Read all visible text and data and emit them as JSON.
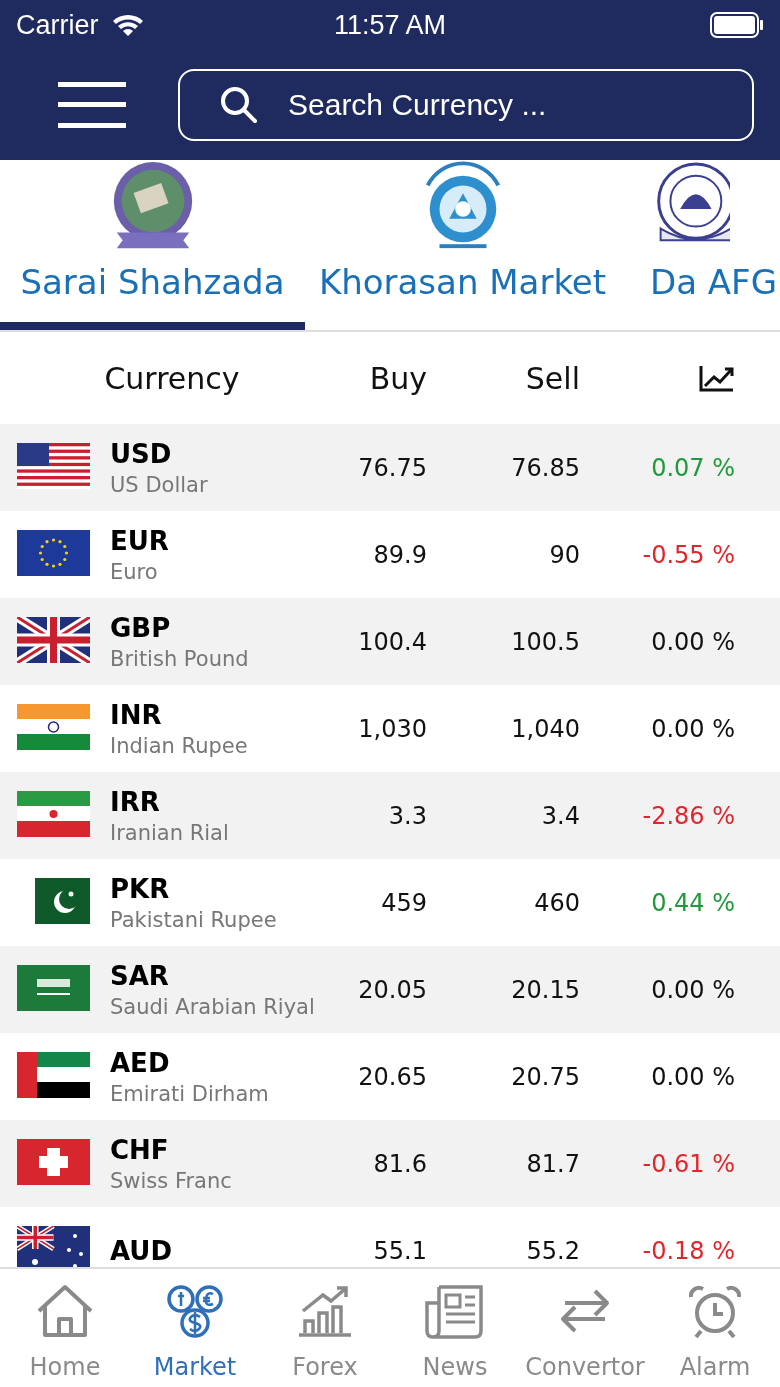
{
  "status_bar": {
    "carrier": "Carrier",
    "time": "11:57 AM"
  },
  "search": {
    "placeholder": "Search Currency ..."
  },
  "markets": [
    {
      "label": "Sarai Shahzada",
      "selected": true
    },
    {
      "label": "Khorasan Market",
      "selected": false
    },
    {
      "label": "Da AFG",
      "selected": false
    }
  ],
  "table": {
    "columns": [
      "Currency",
      "Buy",
      "Sell"
    ],
    "rows": [
      {
        "kind": "us",
        "code": "USD",
        "name": "US Dollar",
        "buy": "76.75",
        "sell": "76.85",
        "change": "0.07 %",
        "color": "#1f9a3a"
      },
      {
        "kind": "eu",
        "code": "EUR",
        "name": "Euro",
        "buy": "89.9",
        "sell": "90",
        "change": "-0.55 %",
        "color": "#e0262c"
      },
      {
        "kind": "gb",
        "code": "GBP",
        "name": "British Pound",
        "buy": "100.4",
        "sell": "100.5",
        "change": "0.00 %",
        "color": "#111111"
      },
      {
        "kind": "in",
        "code": "INR",
        "name": "Indian Rupee",
        "buy": "1,030",
        "sell": "1,040",
        "change": "0.00 %",
        "color": "#111111"
      },
      {
        "kind": "ir",
        "code": "IRR",
        "name": "Iranian Rial",
        "buy": "3.3",
        "sell": "3.4",
        "change": "-2.86 %",
        "color": "#e0262c"
      },
      {
        "kind": "pk",
        "code": "PKR",
        "name": "Pakistani Rupee",
        "buy": "459",
        "sell": "460",
        "change": "0.44 %",
        "color": "#1f9a3a"
      },
      {
        "kind": "sa",
        "code": "SAR",
        "name": "Saudi Arabian Riyal",
        "buy": "20.05",
        "sell": "20.15",
        "change": "0.00 %",
        "color": "#111111"
      },
      {
        "kind": "ae",
        "code": "AED",
        "name": "Emirati Dirham",
        "buy": "20.65",
        "sell": "20.75",
        "change": "0.00 %",
        "color": "#111111"
      },
      {
        "kind": "ch",
        "code": "CHF",
        "name": "Swiss Franc",
        "buy": "81.6",
        "sell": "81.7",
        "change": "-0.61 %",
        "color": "#e0262c"
      },
      {
        "kind": "au",
        "code": "AUD",
        "buy": "55.1",
        "sell": "55.2",
        "change": "-0.18 %",
        "color": "#e0262c"
      }
    ]
  },
  "tab_bar": [
    {
      "kind": "home",
      "label": "Home",
      "selected": false
    },
    {
      "kind": "market",
      "label": "Market",
      "selected": true
    },
    {
      "kind": "forex",
      "label": "Forex",
      "selected": false
    },
    {
      "kind": "news",
      "label": "News",
      "selected": false
    },
    {
      "kind": "convertor",
      "label": "Convertor",
      "selected": false
    },
    {
      "kind": "alarm",
      "label": "Alarm",
      "selected": false
    }
  ]
}
